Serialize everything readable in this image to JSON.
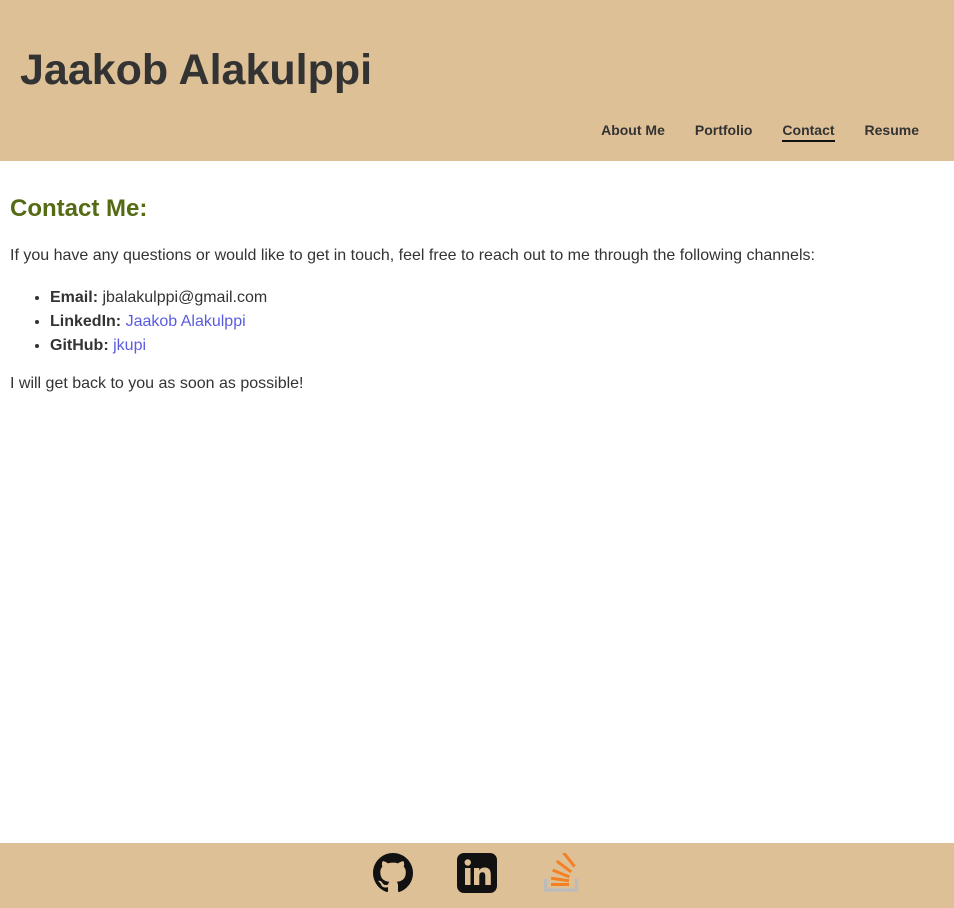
{
  "header": {
    "title": "Jaakob Alakulppi",
    "nav": [
      {
        "label": "About Me",
        "active": false
      },
      {
        "label": "Portfolio",
        "active": false
      },
      {
        "label": "Contact",
        "active": true
      },
      {
        "label": "Resume",
        "active": false
      }
    ]
  },
  "main": {
    "heading": "Contact Me:",
    "intro": "If you have any questions or would like to get in touch, feel free to reach out to me through the following channels:",
    "contacts": [
      {
        "label": "Email:",
        "value": "jbalakulppi@gmail.com",
        "link": false
      },
      {
        "label": "LinkedIn:",
        "value": "Jaakob Alakulppi",
        "link": true
      },
      {
        "label": "GitHub:",
        "value": "jkupi",
        "link": true
      }
    ],
    "outro": "I will get back to you as soon as possible!"
  },
  "footer": {
    "icons": [
      "github-icon",
      "linkedin-icon",
      "stackoverflow-icon"
    ]
  },
  "colors": {
    "header_bg": "#dec097",
    "heading": "#556b13",
    "link": "#5a5ce0",
    "text": "#333333",
    "stackoverflow_orange": "#f48024"
  }
}
